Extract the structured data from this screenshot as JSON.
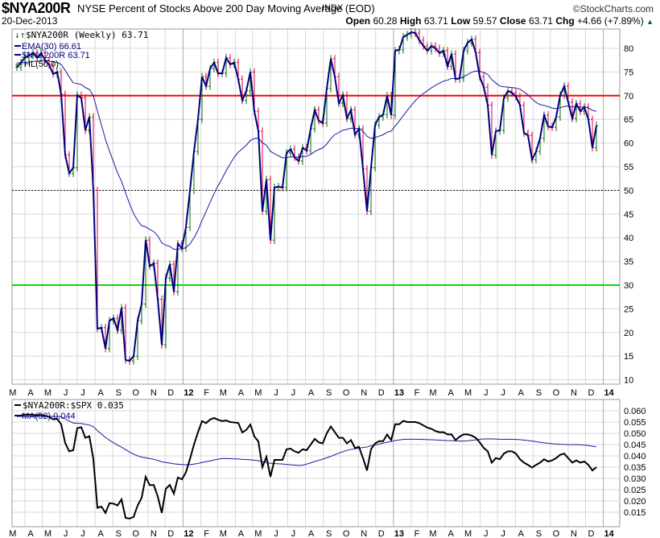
{
  "header": {
    "symbol": "$NYA200R",
    "title": "NYSE Percent of Stocks Above 200 Day Moving Average (EOD)",
    "exchange": "INDX",
    "copyright": "©StockCharts.com",
    "date": "20-Dec-2013",
    "open_label": "Open",
    "open": "60.28",
    "high_label": "High",
    "high": "63.71",
    "low_label": "Low",
    "low": "59.57",
    "close_label": "Close",
    "close": "63.71",
    "chg_label": "Chg",
    "chg": "+4.66 (+7.89%)",
    "up_arrow": "▲"
  },
  "colors": {
    "up": "#007000",
    "down": "#e0003c",
    "price": "#000080",
    "ema": "#1a1aa0",
    "ratio": "#000000",
    "ma": "#1a1aa0",
    "line70": "#ff0000",
    "line30": "#00e000",
    "grid": "#d8d8d8"
  },
  "chart_data": [
    {
      "type": "line",
      "title": "$NYA200R (Weekly)",
      "legend": [
        "$NYA200R (Weekly) 63.71",
        "EMA(30) 66.61",
        "$NYA200R  63.71",
        "HL(50.0)"
      ],
      "legend_placement": "top-left",
      "ylim": [
        8,
        85
      ],
      "yticks": [
        "10",
        "15",
        "20",
        "25",
        "30",
        "35",
        "40",
        "45",
        "50",
        "55",
        "60",
        "65",
        "70",
        "75",
        "80"
      ],
      "reference_lines": [
        70,
        50,
        30
      ],
      "ema_period": 30,
      "x_start": "2011-03",
      "x_end": "2013-12-20",
      "x_ticks": [
        "M",
        "A",
        "M",
        "J",
        "J",
        "A",
        "S",
        "O",
        "N",
        "D",
        "12",
        "F",
        "M",
        "A",
        "M",
        "J",
        "J",
        "A",
        "S",
        "O",
        "N",
        "D",
        "13",
        "F",
        "M",
        "A",
        "M",
        "J",
        "J",
        "A",
        "S",
        "O",
        "N",
        "D",
        "14"
      ],
      "close": [
        76,
        77,
        78,
        78.5,
        79,
        78,
        79,
        77.5,
        76.5,
        74.6,
        75,
        70.3,
        57.5,
        53.6,
        54.8,
        70.1,
        69.5,
        62.7,
        65.5,
        50,
        20.8,
        21,
        16.6,
        22.5,
        23,
        20.5,
        25.2,
        14.2,
        14,
        15,
        22.5,
        26,
        39.5,
        34,
        34.6,
        27,
        17.4,
        31.5,
        34.4,
        28.6,
        38.7,
        37.8,
        42.2,
        50,
        58.2,
        65,
        74,
        72,
        75.7,
        77,
        74.7,
        74.7,
        78,
        76.6,
        77,
        73.5,
        69,
        71,
        75,
        66.7,
        62.5,
        45.6,
        52.3,
        39.5,
        50.6,
        50.8,
        50.6,
        57.9,
        58.7,
        57,
        56.2,
        59,
        58.4,
        63,
        67,
        64.7,
        64.2,
        71.5,
        77.8,
        74,
        68.4,
        70.1,
        65.2,
        67,
        61.8,
        63,
        54.5,
        45.6,
        54.8,
        63.8,
        65.5,
        66,
        70,
        65.9,
        79.5,
        79.7,
        82.4,
        82.9,
        83.4,
        83.2,
        81.7,
        80.5,
        79.5,
        80.5,
        80,
        79,
        79.5,
        76.2,
        78.8,
        73.5,
        73.7,
        79.5,
        81.2,
        81.9,
        79.1,
        74,
        71.8,
        68,
        57.5,
        62.5,
        62.7,
        69.5,
        71,
        70.6,
        69.8,
        68,
        62.1,
        61.6,
        56.5,
        58.2,
        61,
        65.9,
        63.5,
        63.3,
        65.5,
        70.1,
        72,
        68.6,
        65.2,
        68.3,
        66.7,
        67.6,
        65,
        59,
        63.71
      ]
    },
    {
      "type": "line",
      "title": "$NYA200R:$SPX",
      "legend": [
        "$NYA200R:$SPX  0.035",
        "MA(52) 0.044"
      ],
      "legend_placement": "top-left",
      "ylim": [
        0.01,
        0.0625
      ],
      "yticks": [
        "0.015",
        "0.020",
        "0.025",
        "0.030",
        "0.035",
        "0.040",
        "0.045",
        "0.050",
        "0.055",
        "0.060"
      ],
      "ma_period": 52,
      "ratio": [
        0.0576,
        0.0579,
        0.0583,
        0.0583,
        0.0582,
        0.058,
        0.0582,
        0.0578,
        0.0572,
        0.0562,
        0.0564,
        0.054,
        0.0457,
        0.042,
        0.0425,
        0.0523,
        0.0527,
        0.048,
        0.0487,
        0.0386,
        0.017,
        0.0175,
        0.0147,
        0.019,
        0.0188,
        0.018,
        0.0207,
        0.0125,
        0.0122,
        0.0129,
        0.018,
        0.0214,
        0.0307,
        0.027,
        0.0271,
        0.022,
        0.0147,
        0.0254,
        0.0271,
        0.0232,
        0.0304,
        0.0296,
        0.0327,
        0.0386,
        0.045,
        0.0505,
        0.0554,
        0.0545,
        0.0561,
        0.0568,
        0.056,
        0.0554,
        0.0557,
        0.055,
        0.0548,
        0.0546,
        0.0504,
        0.0515,
        0.0539,
        0.0486,
        0.0464,
        0.035,
        0.0396,
        0.0307,
        0.0382,
        0.0382,
        0.0382,
        0.0429,
        0.0432,
        0.042,
        0.0414,
        0.0429,
        0.0425,
        0.045,
        0.0475,
        0.046,
        0.0455,
        0.05,
        0.053,
        0.0505,
        0.048,
        0.048,
        0.0455,
        0.047,
        0.0435,
        0.044,
        0.039,
        0.0335,
        0.043,
        0.0455,
        0.0465,
        0.0465,
        0.0495,
        0.047,
        0.054,
        0.054,
        0.0555,
        0.055,
        0.055,
        0.055,
        0.0545,
        0.0535,
        0.0525,
        0.052,
        0.051,
        0.0505,
        0.0505,
        0.0495,
        0.0495,
        0.047,
        0.0485,
        0.0495,
        0.0495,
        0.049,
        0.048,
        0.046,
        0.0435,
        0.042,
        0.037,
        0.039,
        0.0385,
        0.041,
        0.042,
        0.042,
        0.041,
        0.0385,
        0.037,
        0.036,
        0.0348,
        0.036,
        0.037,
        0.0385,
        0.0375,
        0.038,
        0.039,
        0.0405,
        0.041,
        0.039,
        0.037,
        0.038,
        0.037,
        0.0375,
        0.036,
        0.0335,
        0.035
      ]
    }
  ]
}
